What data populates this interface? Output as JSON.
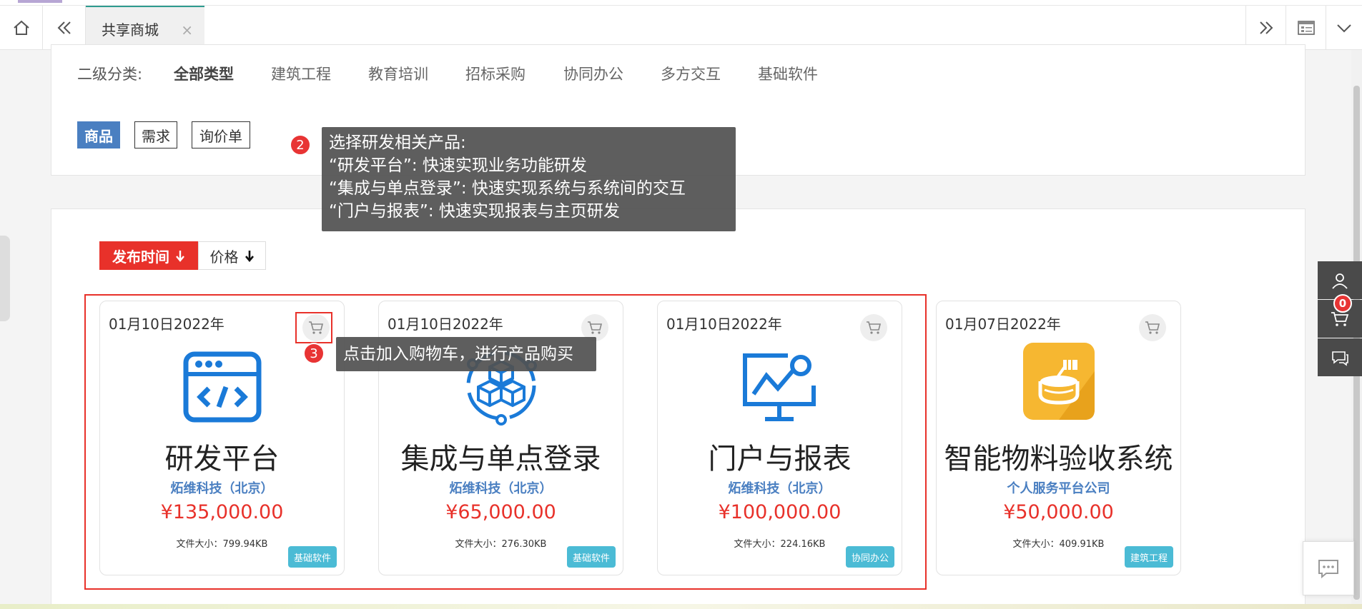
{
  "tabbar": {
    "tab_label": "共享商城",
    "close_glyph": "×"
  },
  "filters": {
    "secondary_label": "二级分类:",
    "categories": [
      "全部类型",
      "建筑工程",
      "教育培训",
      "招标采购",
      "协同办公",
      "多方交互",
      "基础软件"
    ],
    "types": [
      "商品",
      "需求",
      "询价单"
    ]
  },
  "tooltips": {
    "step2": {
      "num": "2",
      "lines": [
        "选择研发相关产品:",
        "“研发平台”: 快速实现业务功能研发",
        "“集成与单点登录”: 快速实现系统与系统间的交互",
        "“门户与报表”: 快速实现报表与主页研发"
      ]
    },
    "step3": {
      "num": "3",
      "text": "点击加入购物车，进行产品购买"
    }
  },
  "sort": {
    "time_label": "发布时间",
    "price_label": "价格"
  },
  "products": [
    {
      "date": "01月10日2022年",
      "name": "研发平台",
      "vendor": "炻维科技（北京）",
      "price": "¥135,000.00",
      "size": "文件大小：799.94KB",
      "tag": "基础软件",
      "icon": "code-window-icon"
    },
    {
      "date": "01月10日2022年",
      "name": "集成与单点登录",
      "vendor": "炻维科技（北京）",
      "price": "¥65,000.00",
      "size": "文件大小：276.30KB",
      "tag": "基础软件",
      "icon": "cubes-network-icon"
    },
    {
      "date": "01月10日2022年",
      "name": "门户与报表",
      "vendor": "炻维科技（北京）",
      "price": "¥100,000.00",
      "size": "文件大小：224.16KB",
      "tag": "协同办公",
      "icon": "chart-monitor-icon"
    },
    {
      "date": "01月07日2022年",
      "name": "智能物料验收系统",
      "vendor": "个人服务平台公司",
      "price": "¥50,000.00",
      "size": "文件大小：409.91KB",
      "tag": "建筑工程",
      "icon": "paint-bucket-icon"
    }
  ],
  "side": {
    "cart_count": "0"
  },
  "colors": {
    "accent_blue": "#4a7fc1",
    "price_red": "#e8312a",
    "tag_cyan": "#4bbbd5",
    "sort_red": "#e8312a"
  }
}
